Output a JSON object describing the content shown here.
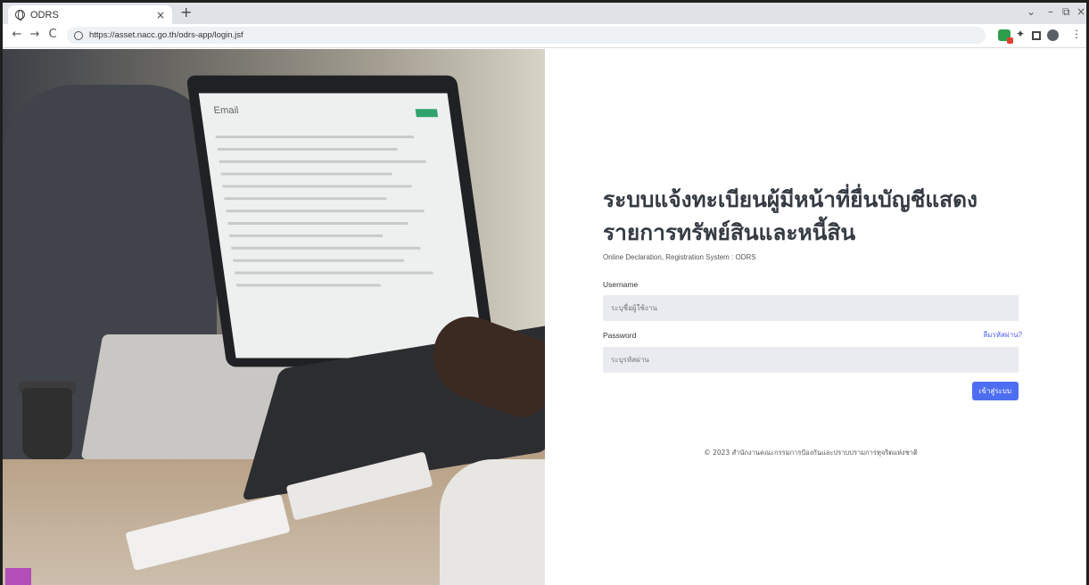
{
  "browser": {
    "tab_title": "ODRS",
    "tab_close": "×",
    "new_tab": "+",
    "url": "https://asset.nacc.go.th/odrs-app/login.jsf",
    "nav": {
      "back": "←",
      "forward": "→",
      "reload": "C"
    },
    "window": {
      "dropdown": "⌄",
      "minimize": "–",
      "restore": "⧉",
      "close": "×"
    },
    "ext_pin": "✦",
    "ext_menu": "⋮"
  },
  "hero_image": {
    "screen_text": "Email"
  },
  "login": {
    "title_line1": "ระบบแจ้งทะเบียนผู้มีหน้าที่ยื่นบัญชีแสดง",
    "title_line2": "รายการทรัพย์สินและหนี้สิน",
    "subtitle": "Online Declaration, Registration System : ODRS",
    "username_label": "Username",
    "username_placeholder": "ระบุชื่อผู้ใช้งาน",
    "password_label": "Password",
    "forgot_password": "ลืมรหัสผ่าน?",
    "password_placeholder": "ระบุรหัสผ่าน",
    "submit_label": "เข้าสู่ระบบ"
  },
  "footer": {
    "text": "© 2023 สำนักงานคณะกรรมการป้องกันและปราบปรามการทุจริตแห่งชาติ"
  },
  "colors": {
    "accent": "#4e6ef2",
    "field_bg": "#e9ebf0",
    "title": "#353b43"
  }
}
